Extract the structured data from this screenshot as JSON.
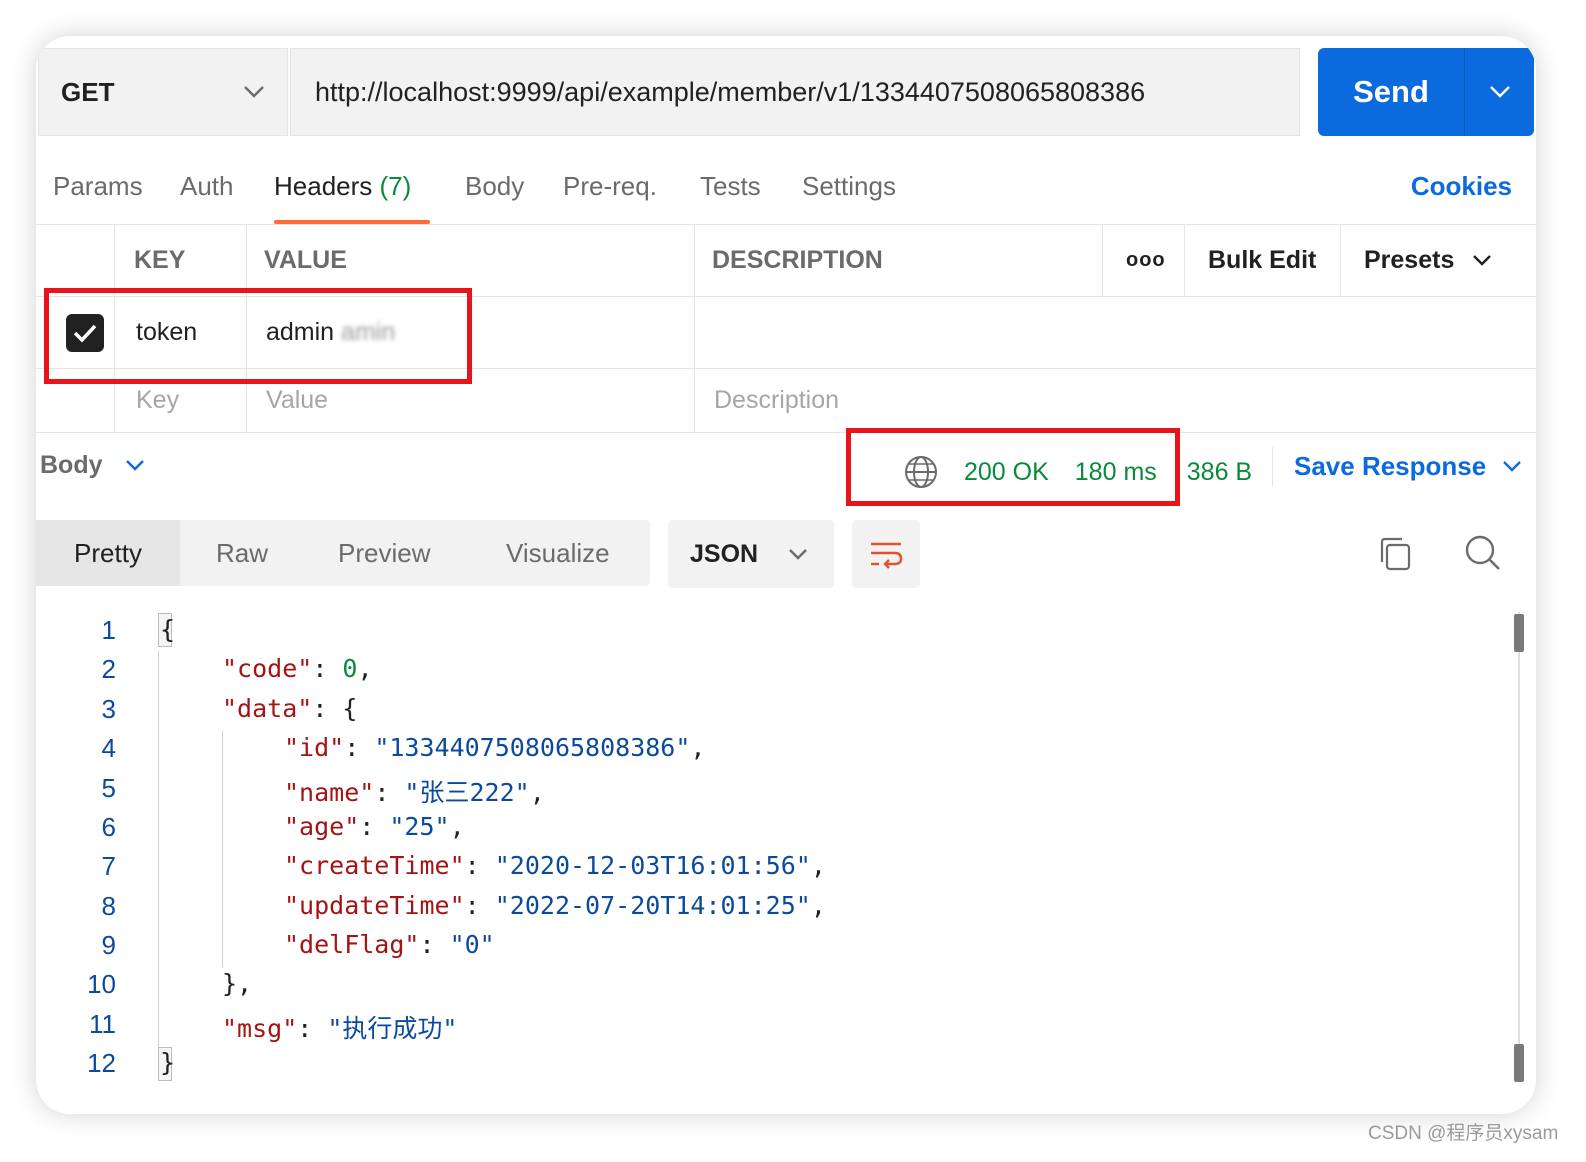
{
  "request": {
    "method": "GET",
    "url": "http://localhost:9999/api/example/member/v1/1334407508065808386",
    "send_label": "Send"
  },
  "tabs": {
    "params": "Params",
    "auth": "Auth",
    "headers": "Headers",
    "headers_count": "(7)",
    "body": "Body",
    "prereq": "Pre-req.",
    "tests": "Tests",
    "settings": "Settings",
    "cookies": "Cookies"
  },
  "headers_table": {
    "col_key": "KEY",
    "col_value": "VALUE",
    "col_description": "DESCRIPTION",
    "more": "ooo",
    "bulk_edit": "Bulk Edit",
    "presets": "Presets",
    "rows": [
      {
        "key": "token",
        "value": "admin",
        "value_obscured": "amin"
      }
    ],
    "placeholder_key": "Key",
    "placeholder_value": "Value",
    "placeholder_description": "Description"
  },
  "response": {
    "body_label": "Body",
    "status": "200 OK",
    "time": "180 ms",
    "size": "386 B",
    "save_response": "Save Response"
  },
  "view_tabs": [
    "Pretty",
    "Raw",
    "Preview",
    "Visualize"
  ],
  "format": "JSON",
  "code": {
    "line_numbers": [
      "1",
      "2",
      "3",
      "4",
      "5",
      "6",
      "7",
      "8",
      "9",
      "10",
      "11",
      "12"
    ],
    "open_brace": "{",
    "close_brace": "}",
    "code_key": "\"code\"",
    "code_value": "0",
    "data_key": "\"data\"",
    "data_open": "{",
    "data_close": "},",
    "id_key": "\"id\"",
    "id_value": "\"1334407508065808386\"",
    "name_key": "\"name\"",
    "name_value": "\"张三222\"",
    "age_key": "\"age\"",
    "age_value": "\"25\"",
    "create_key": "\"createTime\"",
    "create_value": "\"2020-12-03T16:01:56\"",
    "update_key": "\"updateTime\"",
    "update_value": "\"2022-07-20T14:01:25\"",
    "del_key": "\"delFlag\"",
    "del_value": "\"0\"",
    "msg_key": "\"msg\"",
    "msg_value": "\"执行成功\""
  },
  "watermark": "CSDN @程序员xysam",
  "colors": {
    "accent_blue": "#0b6bde",
    "tab_underline": "#ff6c37",
    "success_green": "#0a8a3a",
    "highlight_red": "#e8141c"
  }
}
